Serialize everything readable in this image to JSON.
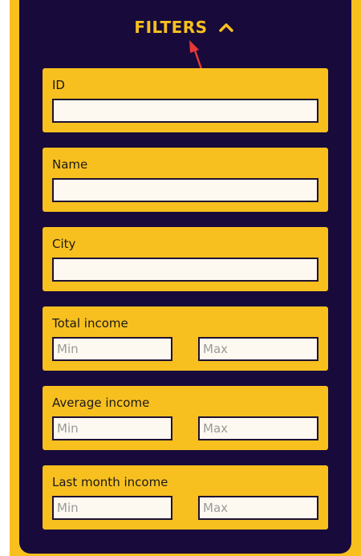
{
  "header": {
    "title": "FILTERS",
    "toggle_icon": "chevron-up-icon"
  },
  "colors": {
    "accent": "#f8c01f",
    "panel": "#180a3a",
    "input_bg": "#fdf8f0",
    "annotation": "#e53935"
  },
  "filters": {
    "id": {
      "label": "ID",
      "value": ""
    },
    "name": {
      "label": "Name",
      "value": ""
    },
    "city": {
      "label": "City",
      "value": ""
    },
    "total_income": {
      "label": "Total income",
      "min_placeholder": "Min",
      "max_placeholder": "Max"
    },
    "average_income": {
      "label": "Average income",
      "min_placeholder": "Min",
      "max_placeholder": "Max"
    },
    "last_month_income": {
      "label": "Last month income",
      "min_placeholder": "Min",
      "max_placeholder": "Max"
    }
  }
}
